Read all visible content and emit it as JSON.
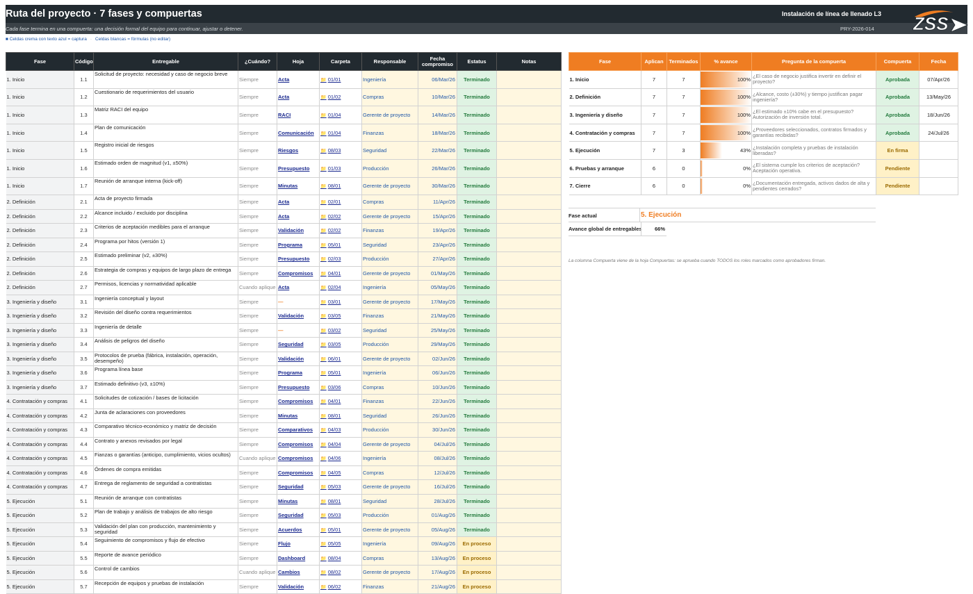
{
  "header": {
    "title": "Ruta del proyecto · 7 fases y compuertas",
    "project_name": "Instalación de línea de llenado L3",
    "subtitle": "Cada fase termina en una compuerta: una decisión formal del equipo para continuar, ajustar o detener.",
    "project_code": "PRY-2026-014",
    "logo_text": "ZSS"
  },
  "legend": {
    "capture": "■ Celdas crema con texto azul = captura",
    "formula": "Celdas blancas = fórmulas (no editar)"
  },
  "deliverables": {
    "columns": [
      "Fase",
      "Código",
      "Entregable",
      "¿Cuándo?",
      "Hoja",
      "Carpeta",
      "Responsable",
      "Fecha compromiso",
      "Estatus",
      "Notas"
    ],
    "rows": [
      {
        "phase": "1. Inicio",
        "code": "1.1",
        "deliverable": "Solicitud de proyecto: necesidad y caso de negocio breve",
        "when": "Siempre",
        "sheet": "Acta",
        "folder": "01/01",
        "owner": "Ingeniería",
        "date": "06/Mar/26",
        "status": "Terminado",
        "notes": ""
      },
      {
        "phase": "1. Inicio",
        "code": "1.2",
        "deliverable": "Cuestionario de requerimientos del usuario",
        "when": "Siempre",
        "sheet": "Acta",
        "folder": "01/02",
        "owner": "Compras",
        "date": "10/Mar/26",
        "status": "Terminado",
        "notes": ""
      },
      {
        "phase": "1. Inicio",
        "code": "1.3",
        "deliverable": "Matriz RACI del equipo",
        "when": "Siempre",
        "sheet": "RACI",
        "folder": "01/04",
        "owner": "Gerente de proyecto",
        "date": "14/Mar/26",
        "status": "Terminado",
        "notes": ""
      },
      {
        "phase": "1. Inicio",
        "code": "1.4",
        "deliverable": "Plan de comunicación",
        "when": "Siempre",
        "sheet": "Comunicación",
        "folder": "01/04",
        "owner": "Finanzas",
        "date": "18/Mar/26",
        "status": "Terminado",
        "notes": ""
      },
      {
        "phase": "1. Inicio",
        "code": "1.5",
        "deliverable": "Registro inicial de riesgos",
        "when": "Siempre",
        "sheet": "Riesgos",
        "folder": "08/03",
        "owner": "Seguridad",
        "date": "22/Mar/26",
        "status": "Terminado",
        "notes": ""
      },
      {
        "phase": "1. Inicio",
        "code": "1.6",
        "deliverable": "Estimado orden de magnitud (v1, ±50%)",
        "when": "Siempre",
        "sheet": "Presupuesto",
        "folder": "01/03",
        "owner": "Producción",
        "date": "26/Mar/26",
        "status": "Terminado",
        "notes": ""
      },
      {
        "phase": "1. Inicio",
        "code": "1.7",
        "deliverable": "Reunión de arranque interna (kick-off)",
        "when": "Siempre",
        "sheet": "Minutas",
        "folder": "08/01",
        "owner": "Gerente de proyecto",
        "date": "30/Mar/26",
        "status": "Terminado",
        "notes": ""
      },
      {
        "phase": "2. Definición",
        "code": "2.1",
        "deliverable": "Acta de proyecto firmada",
        "when": "Siempre",
        "sheet": "Acta",
        "folder": "02/01",
        "owner": "Compras",
        "date": "11/Apr/26",
        "status": "Terminado",
        "notes": ""
      },
      {
        "phase": "2. Definición",
        "code": "2.2",
        "deliverable": "Alcance incluido / excluido por disciplina",
        "when": "Siempre",
        "sheet": "Acta",
        "folder": "02/02",
        "owner": "Gerente de proyecto",
        "date": "15/Apr/26",
        "status": "Terminado",
        "notes": ""
      },
      {
        "phase": "2. Definición",
        "code": "2.3",
        "deliverable": "Criterios de aceptación medibles para el arranque",
        "when": "Siempre",
        "sheet": "Validación",
        "folder": "02/02",
        "owner": "Finanzas",
        "date": "19/Apr/26",
        "status": "Terminado",
        "notes": ""
      },
      {
        "phase": "2. Definición",
        "code": "2.4",
        "deliverable": "Programa por hitos (versión 1)",
        "when": "Siempre",
        "sheet": "Programa",
        "folder": "05/01",
        "owner": "Seguridad",
        "date": "23/Apr/26",
        "status": "Terminado",
        "notes": ""
      },
      {
        "phase": "2. Definición",
        "code": "2.5",
        "deliverable": "Estimado preliminar (v2, ±30%)",
        "when": "Siempre",
        "sheet": "Presupuesto",
        "folder": "02/03",
        "owner": "Producción",
        "date": "27/Apr/26",
        "status": "Terminado",
        "notes": ""
      },
      {
        "phase": "2. Definición",
        "code": "2.6",
        "deliverable": "Estrategia de compras y equipos de largo plazo de entrega",
        "when": "Siempre",
        "sheet": "Compromisos",
        "folder": "04/01",
        "owner": "Gerente de proyecto",
        "date": "01/May/26",
        "status": "Terminado",
        "notes": ""
      },
      {
        "phase": "2. Definición",
        "code": "2.7",
        "deliverable": "Permisos, licencias y normatividad aplicable",
        "when": "Cuando aplique",
        "sheet": "Acta",
        "folder": "02/04",
        "owner": "Ingeniería",
        "date": "05/May/26",
        "status": "Terminado",
        "notes": ""
      },
      {
        "phase": "3. Ingeniería y diseño",
        "code": "3.1",
        "deliverable": "Ingeniería conceptual y layout",
        "when": "Siempre",
        "sheet": "—",
        "folder": "03/01",
        "owner": "Gerente de proyecto",
        "date": "17/May/26",
        "status": "Terminado",
        "notes": ""
      },
      {
        "phase": "3. Ingeniería y diseño",
        "code": "3.2",
        "deliverable": "Revisión del diseño contra requerimientos",
        "when": "Siempre",
        "sheet": "Validación",
        "folder": "03/05",
        "owner": "Finanzas",
        "date": "21/May/26",
        "status": "Terminado",
        "notes": ""
      },
      {
        "phase": "3. Ingeniería y diseño",
        "code": "3.3",
        "deliverable": "Ingeniería de detalle",
        "when": "Siempre",
        "sheet": "—",
        "folder": "03/02",
        "owner": "Seguridad",
        "date": "25/May/26",
        "status": "Terminado",
        "notes": ""
      },
      {
        "phase": "3. Ingeniería y diseño",
        "code": "3.4",
        "deliverable": "Análisis de peligros del diseño",
        "when": "Siempre",
        "sheet": "Seguridad",
        "folder": "03/05",
        "owner": "Producción",
        "date": "29/May/26",
        "status": "Terminado",
        "notes": ""
      },
      {
        "phase": "3. Ingeniería y diseño",
        "code": "3.5",
        "deliverable": "Protocolos de prueba (fábrica, instalación, operación, desempeño)",
        "when": "Siempre",
        "sheet": "Validación",
        "folder": "06/01",
        "owner": "Gerente de proyecto",
        "date": "02/Jun/26",
        "status": "Terminado",
        "notes": ""
      },
      {
        "phase": "3. Ingeniería y diseño",
        "code": "3.6",
        "deliverable": "Programa línea base",
        "when": "Siempre",
        "sheet": "Programa",
        "folder": "05/01",
        "owner": "Ingeniería",
        "date": "06/Jun/26",
        "status": "Terminado",
        "notes": ""
      },
      {
        "phase": "3. Ingeniería y diseño",
        "code": "3.7",
        "deliverable": "Estimado definitivo (v3, ±10%)",
        "when": "Siempre",
        "sheet": "Presupuesto",
        "folder": "03/06",
        "owner": "Compras",
        "date": "10/Jun/26",
        "status": "Terminado",
        "notes": ""
      },
      {
        "phase": "4. Contratación y compras",
        "code": "4.1",
        "deliverable": "Solicitudes de cotización / bases de licitación",
        "when": "Siempre",
        "sheet": "Compromisos",
        "folder": "04/01",
        "owner": "Finanzas",
        "date": "22/Jun/26",
        "status": "Terminado",
        "notes": ""
      },
      {
        "phase": "4. Contratación y compras",
        "code": "4.2",
        "deliverable": "Junta de aclaraciones con proveedores",
        "when": "Siempre",
        "sheet": "Minutas",
        "folder": "08/01",
        "owner": "Seguridad",
        "date": "26/Jun/26",
        "status": "Terminado",
        "notes": ""
      },
      {
        "phase": "4. Contratación y compras",
        "code": "4.3",
        "deliverable": "Comparativo técnico-económico y matriz de decisión",
        "when": "Siempre",
        "sheet": "Comparativos",
        "folder": "04/03",
        "owner": "Producción",
        "date": "30/Jun/26",
        "status": "Terminado",
        "notes": ""
      },
      {
        "phase": "4. Contratación y compras",
        "code": "4.4",
        "deliverable": "Contrato y anexos revisados por legal",
        "when": "Siempre",
        "sheet": "Compromisos",
        "folder": "04/04",
        "owner": "Gerente de proyecto",
        "date": "04/Jul/26",
        "status": "Terminado",
        "notes": ""
      },
      {
        "phase": "4. Contratación y compras",
        "code": "4.5",
        "deliverable": "Fianzas o garantías (anticipo, cumplimiento, vicios ocultos)",
        "when": "Cuando aplique",
        "sheet": "Compromisos",
        "folder": "04/06",
        "owner": "Ingeniería",
        "date": "08/Jul/26",
        "status": "Terminado",
        "notes": ""
      },
      {
        "phase": "4. Contratación y compras",
        "code": "4.6",
        "deliverable": "Órdenes de compra emitidas",
        "when": "Siempre",
        "sheet": "Compromisos",
        "folder": "04/05",
        "owner": "Compras",
        "date": "12/Jul/26",
        "status": "Terminado",
        "notes": ""
      },
      {
        "phase": "4. Contratación y compras",
        "code": "4.7",
        "deliverable": "Entrega de reglamento de seguridad a contratistas",
        "when": "Siempre",
        "sheet": "Seguridad",
        "folder": "05/03",
        "owner": "Gerente de proyecto",
        "date": "16/Jul/26",
        "status": "Terminado",
        "notes": ""
      },
      {
        "phase": "5. Ejecución",
        "code": "5.1",
        "deliverable": "Reunión de arranque con contratistas",
        "when": "Siempre",
        "sheet": "Minutas",
        "folder": "08/01",
        "owner": "Seguridad",
        "date": "28/Jul/26",
        "status": "Terminado",
        "notes": ""
      },
      {
        "phase": "5. Ejecución",
        "code": "5.2",
        "deliverable": "Plan de trabajo y análisis de trabajos de alto riesgo",
        "when": "Siempre",
        "sheet": "Seguridad",
        "folder": "05/03",
        "owner": "Producción",
        "date": "01/Aug/26",
        "status": "Terminado",
        "notes": ""
      },
      {
        "phase": "5. Ejecución",
        "code": "5.3",
        "deliverable": "Validación del plan con producción, mantenimiento y seguridad",
        "when": "Siempre",
        "sheet": "Acuerdos",
        "folder": "05/01",
        "owner": "Gerente de proyecto",
        "date": "05/Aug/26",
        "status": "Terminado",
        "notes": ""
      },
      {
        "phase": "5. Ejecución",
        "code": "5.4",
        "deliverable": "Seguimiento de compromisos y flujo de efectivo",
        "when": "Siempre",
        "sheet": "Flujo",
        "folder": "05/05",
        "owner": "Ingeniería",
        "date": "09/Aug/26",
        "status": "En proceso",
        "notes": ""
      },
      {
        "phase": "5. Ejecución",
        "code": "5.5",
        "deliverable": "Reporte de avance periódico",
        "when": "Siempre",
        "sheet": "Dashboard",
        "folder": "08/04",
        "owner": "Compras",
        "date": "13/Aug/26",
        "status": "En proceso",
        "notes": ""
      },
      {
        "phase": "5. Ejecución",
        "code": "5.6",
        "deliverable": "Control de cambios",
        "when": "Cuando aplique",
        "sheet": "Cambios",
        "folder": "08/02",
        "owner": "Gerente de proyecto",
        "date": "17/Aug/26",
        "status": "En proceso",
        "notes": ""
      },
      {
        "phase": "5. Ejecución",
        "code": "5.7",
        "deliverable": "Recepción de equipos y pruebas de instalación",
        "when": "Siempre",
        "sheet": "Validación",
        "folder": "06/02",
        "owner": "Finanzas",
        "date": "21/Aug/26",
        "status": "En proceso",
        "notes": ""
      }
    ]
  },
  "gates": {
    "columns": [
      "Fase",
      "Aplican",
      "Terminados",
      "% avance",
      "Pregunta de la compuerta",
      "Compuerta",
      "Fecha"
    ],
    "rows": [
      {
        "phase": "1. Inicio",
        "apply": "7",
        "done": "7",
        "pct_label": "100%",
        "pct": 1.0,
        "question": "¿El caso de negocio justifica invertir en definir el proyecto?",
        "gate": "Aprobada",
        "gate_kind": "ok",
        "date": "07/Apr/26"
      },
      {
        "phase": "2. Definición",
        "apply": "7",
        "done": "7",
        "pct_label": "100%",
        "pct": 1.0,
        "question": "¿Alcance, costo (±30%) y tiempo justifican pagar ingeniería?",
        "gate": "Aprobada",
        "gate_kind": "ok",
        "date": "13/May/26"
      },
      {
        "phase": "3. Ingeniería y diseño",
        "apply": "7",
        "done": "7",
        "pct_label": "100%",
        "pct": 1.0,
        "question": "¿El estimado ±10% cabe en el presupuesto? Autorización de inversión total.",
        "gate": "Aprobada",
        "gate_kind": "ok",
        "date": "18/Jun/26"
      },
      {
        "phase": "4. Contratación y compras",
        "apply": "7",
        "done": "7",
        "pct_label": "100%",
        "pct": 1.0,
        "question": "¿Proveedores seleccionados, contratos firmados y garantías recibidas?",
        "gate": "Aprobada",
        "gate_kind": "ok",
        "date": "24/Jul/26"
      },
      {
        "phase": "5. Ejecución",
        "apply": "7",
        "done": "3",
        "pct_label": "43%",
        "pct": 0.43,
        "question": "¿Instalación completa y pruebas de instalación liberadas?",
        "gate": "En firma",
        "gate_kind": "sign",
        "date": ""
      },
      {
        "phase": "6. Pruebas y arranque",
        "apply": "6",
        "done": "0",
        "pct_label": "0%",
        "pct": 0.0,
        "question": "¿El sistema cumple los criterios de aceptación? Aceptación operativa.",
        "gate": "Pendiente",
        "gate_kind": "pend",
        "date": ""
      },
      {
        "phase": "7. Cierre",
        "apply": "6",
        "done": "0",
        "pct_label": "0%",
        "pct": 0.0,
        "question": "¿Documentación entregada, activos dados de alta y pendientes cerrados?",
        "gate": "Pendiente",
        "gate_kind": "pend",
        "date": ""
      }
    ]
  },
  "summary": {
    "current_phase_label": "Fase actual",
    "current_phase_value": "5. Ejecución",
    "overall_label": "Avance global de entregables",
    "overall_value": "66%",
    "footnote": "La columna Compuerta viene de la hoja Compuertas: se aprueba cuando TODOS los roles marcados como aprobadores firman."
  },
  "colors": {
    "header_dark": "#222a30",
    "accent_orange": "#ef7d22",
    "done_green": "#237a3d",
    "pending_amber": "#9a6a00",
    "capture_blue": "#1f57a8"
  }
}
